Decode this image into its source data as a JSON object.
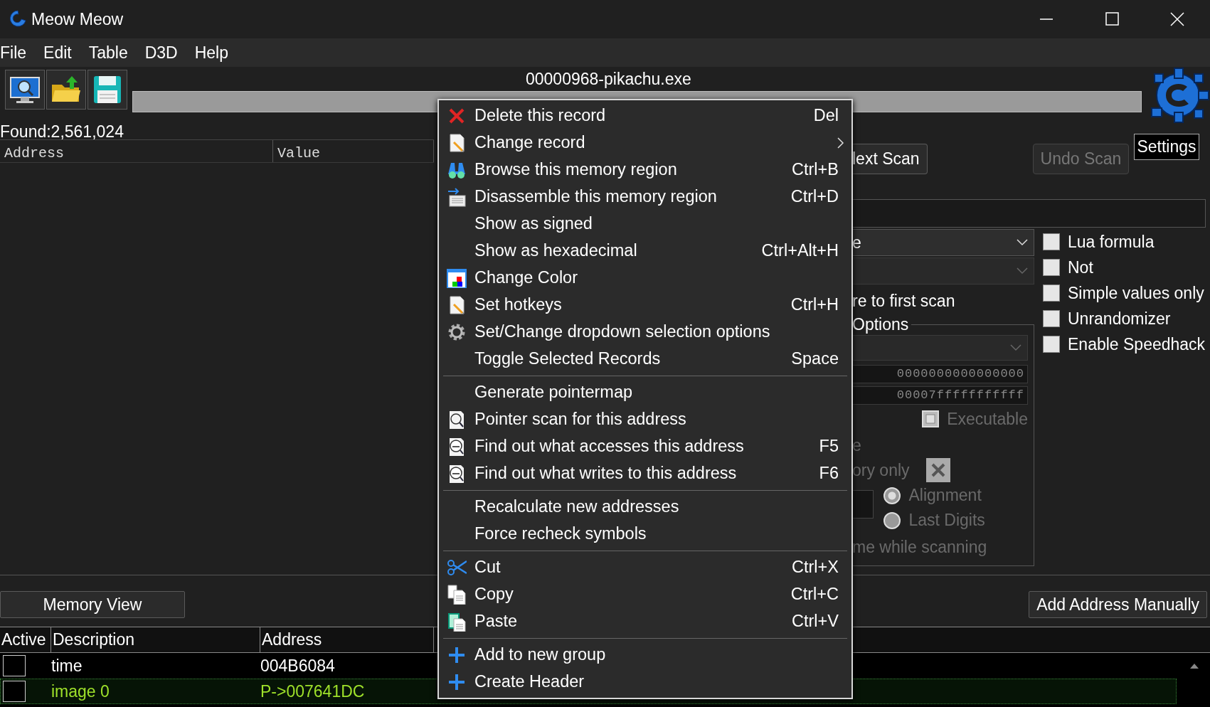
{
  "window": {
    "title": "Meow Meow"
  },
  "menu_bar": [
    {
      "label": "File"
    },
    {
      "label": "Edit"
    },
    {
      "label": "Table"
    },
    {
      "label": "D3D"
    },
    {
      "label": "Help"
    }
  ],
  "process": "00000968-pikachu.exe",
  "progress": {
    "level": 0
  },
  "found": "Found:2,561,024",
  "found_list": {
    "columns": [
      "Address",
      "Value"
    ]
  },
  "scan": {
    "next_scan": {
      "label": "lext Scan",
      "disabled": false
    },
    "undo_scan": {
      "label": "Undo Scan",
      "disabled": true
    },
    "settings": "Settings",
    "value_type": "e",
    "scan_type": {
      "disabled": true
    },
    "compare": "re to first scan",
    "options": {
      "title": "Options",
      "region": {
        "disabled": true
      },
      "start": "0000000000000000",
      "stop": "00007fffffffffff",
      "executable": {
        "label": "Executable",
        "indeterminate": true
      },
      "writable": "e",
      "memory_only": {
        "label": "ory only",
        "checked": true
      },
      "alignment": [
        {
          "label": "Alignment",
          "selected": true
        },
        {
          "label": "Last Digits",
          "selected": false
        }
      ],
      "pause": "me while scanning"
    },
    "checks": [
      {
        "label": "Lua formula",
        "checked": false
      },
      {
        "label": "Not",
        "checked": false
      },
      {
        "label": "Simple values only",
        "checked": false
      },
      {
        "label": "Unrandomizer",
        "checked": false
      },
      {
        "label": "Enable Speedhack",
        "checked": false
      }
    ]
  },
  "buttons": {
    "memory_view": "Memory View",
    "add_address": "Add Address Manually"
  },
  "cheat_table": {
    "columns": [
      "Active",
      "Description",
      "Address"
    ],
    "rows": [
      {
        "active": false,
        "description": "time",
        "address": "004B6084",
        "selected": false
      },
      {
        "active": false,
        "description": "image 0",
        "address": "P->007641DC",
        "selected": true
      }
    ]
  },
  "context_menu": [
    {
      "kind": "delete",
      "label": "Delete this record",
      "shortcut": "Del"
    },
    {
      "kind": "record",
      "label": "Change record",
      "submenu": true
    },
    {
      "kind": "browse",
      "label": "Browse this memory region",
      "shortcut": "Ctrl+B"
    },
    {
      "kind": "disassemble",
      "label": "Disassemble this memory region",
      "shortcut": "Ctrl+D"
    },
    {
      "kind": "plain",
      "label": "Show as signed"
    },
    {
      "kind": "plain",
      "label": "Show as hexadecimal",
      "shortcut": "Ctrl+Alt+H"
    },
    {
      "kind": "color",
      "label": "Change Color"
    },
    {
      "kind": "record",
      "label": "Set hotkeys",
      "shortcut": "Ctrl+H"
    },
    {
      "kind": "options",
      "label": "Set/Change dropdown selection options"
    },
    {
      "kind": "plain",
      "label": "Toggle Selected Records",
      "shortcut": "Space"
    },
    {
      "kind": "separator"
    },
    {
      "kind": "plain",
      "label": "Generate pointermap"
    },
    {
      "kind": "pointer",
      "label": "Pointer scan for this address"
    },
    {
      "kind": "trace",
      "label": "Find out what accesses this address",
      "shortcut": "F5"
    },
    {
      "kind": "trace",
      "label": "Find out what writes to this address",
      "shortcut": "F6"
    },
    {
      "kind": "separator"
    },
    {
      "kind": "plain",
      "label": "Recalculate new addresses"
    },
    {
      "kind": "plain",
      "label": "Force recheck symbols"
    },
    {
      "kind": "separator"
    },
    {
      "kind": "cut",
      "label": "Cut",
      "shortcut": "Ctrl+X"
    },
    {
      "kind": "copy",
      "label": "Copy",
      "shortcut": "Ctrl+C"
    },
    {
      "kind": "paste",
      "label": "Paste",
      "shortcut": "Ctrl+V"
    },
    {
      "kind": "separator"
    },
    {
      "kind": "add",
      "label": "Add to new group"
    },
    {
      "kind": "add",
      "label": "Create Header"
    }
  ]
}
